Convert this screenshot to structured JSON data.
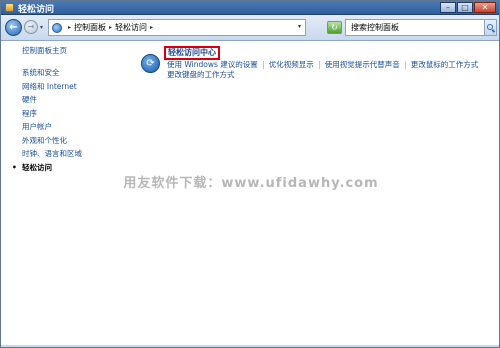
{
  "window": {
    "title": "轻松访问"
  },
  "titlebar_buttons": {
    "minimize": "–",
    "maximize": "□",
    "close": "✕"
  },
  "icons": {
    "back": "back-arrow-icon",
    "forward": "forward-arrow-icon",
    "control_panel": "control-panel-icon",
    "refresh": "refresh-icon",
    "search": "search-icon",
    "ease_of_access": "ease-of-access-icon"
  },
  "addressbar": {
    "back_glyph": "←",
    "forward_glyph": "→",
    "dropdown_glyph": "▾",
    "refresh_glyph": "↻",
    "breadcrumb": [
      "控制面板",
      "轻松访问"
    ],
    "search_placeholder": "搜索控制面板"
  },
  "sidebar": {
    "home": "控制面板主页",
    "items": [
      {
        "label": "系统和安全"
      },
      {
        "label": "网络和 Internet"
      },
      {
        "label": "硬件"
      },
      {
        "label": "程序"
      },
      {
        "label": "用户帐户"
      },
      {
        "label": "外观和个性化"
      },
      {
        "label": "时钟、语言和区域"
      },
      {
        "label": "轻松访问",
        "current": true
      }
    ],
    "current_bullet": "•"
  },
  "category": {
    "title": "轻松访问中心",
    "links": [
      "使用 Windows 建议的设置",
      "优化视频显示",
      "使用视觉提示代替声音",
      "更改鼠标的工作方式",
      "更改键盘的工作方式"
    ]
  },
  "watermark": "用友软件下载：www.ufidawhy.com",
  "colors": {
    "link": "#1a4f9c",
    "highlight_border": "#d8000c",
    "titlebar": "#2f5f9e"
  }
}
